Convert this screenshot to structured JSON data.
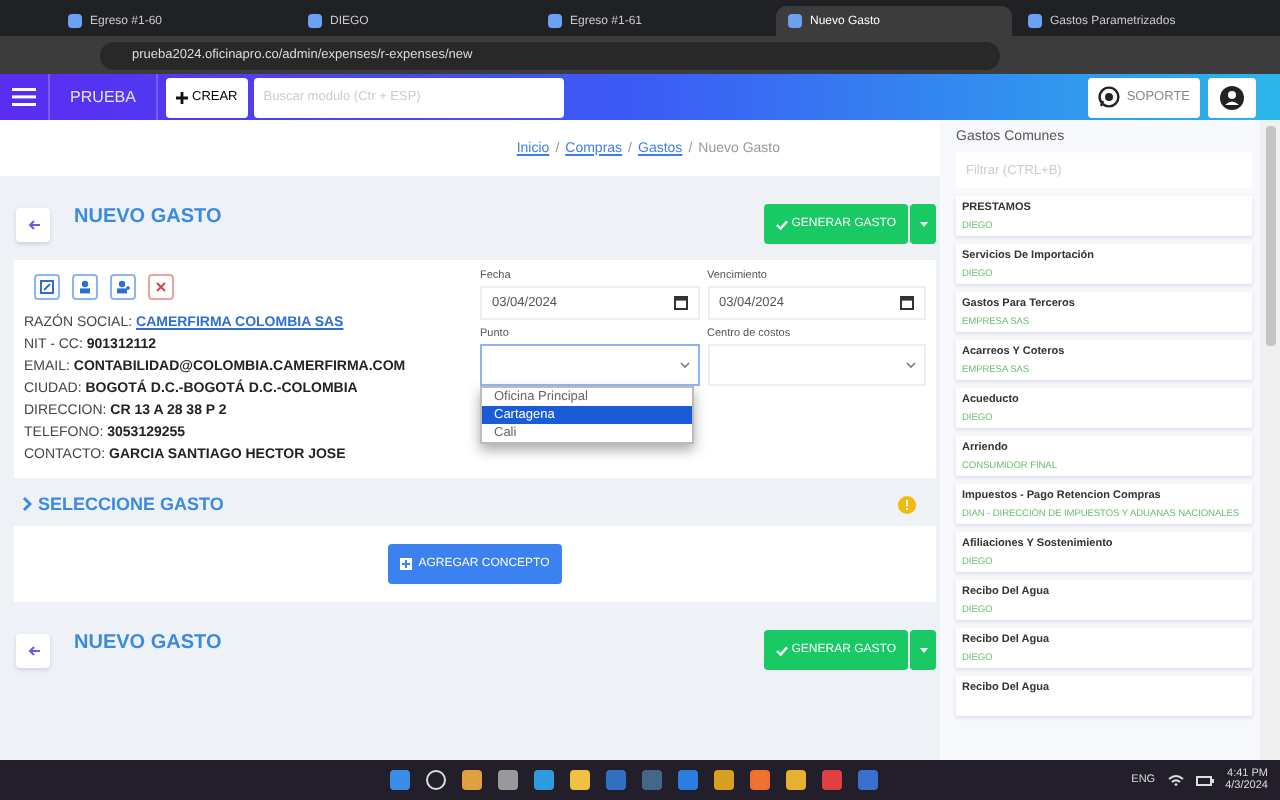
{
  "browser": {
    "tabs": [
      {
        "title": "Egreso #1-60",
        "selected": false
      },
      {
        "title": "DIEGO",
        "selected": false
      },
      {
        "title": "Egreso #1-61",
        "selected": false
      },
      {
        "title": "Nuevo Gasto",
        "selected": true
      },
      {
        "title": "Gastos Parametrizados",
        "selected": false
      }
    ],
    "url": "prueba2024.oficinapro.co/admin/expenses/r-expenses/new"
  },
  "app_header": {
    "brand": "PRUEBA",
    "create_button": "CREAR",
    "search": {
      "placeholder": "Buscar modulo (Ctr + ESP)"
    },
    "support_button": "SOPORTE"
  },
  "breadcrumb": [
    {
      "label": "Inicio",
      "kind": "link"
    },
    {
      "label": "Compras",
      "kind": "link"
    },
    {
      "label": "Gastos",
      "kind": "link"
    },
    {
      "label": "Nuevo Gasto",
      "kind": "current"
    }
  ],
  "separator": "/",
  "page_title": "NUEVO GASTO",
  "generate_button": "GENERAR GASTO",
  "supplier": [
    {
      "label": "RAZÓN SOCIAL:",
      "value": "CAMERFIRMA COLOMBIA SAS",
      "kind": "link"
    },
    {
      "label": "NIT - CC:",
      "value": "901312112",
      "kind": "plain"
    },
    {
      "label": "EMAIL:",
      "value": "CONTABILIDAD@COLOMBIA.CAMERFIRMA.COM",
      "kind": "plain"
    },
    {
      "label": "CIUDAD:",
      "value": "BOGOTÁ D.C.-BOGOTÁ D.C.-COLOMBIA",
      "kind": "plain"
    },
    {
      "label": "DIRECCION:",
      "value": "CR 13 A 28 38 P 2",
      "kind": "plain"
    },
    {
      "label": "TELEFONO:",
      "value": "3053129255",
      "kind": "plain"
    },
    {
      "label": "CONTACTO:",
      "value": "GARCIA SANTIAGO HECTOR JOSE",
      "kind": "plain"
    }
  ],
  "dates": [
    {
      "label": "Fecha",
      "value": "03/04/2024"
    },
    {
      "label": "Vencimiento",
      "value": "03/04/2024"
    }
  ],
  "punto": {
    "label": "Punto",
    "expanded": true,
    "options": [
      {
        "label": "Oficina Principal",
        "selected": false
      },
      {
        "label": "Cartagena",
        "selected": true
      },
      {
        "label": "Cali",
        "selected": false
      }
    ]
  },
  "cost_center": {
    "label": "Centro de costos"
  },
  "section_title": "SELECCIONE GASTO",
  "add_button": "AGREGAR CONCEPTO",
  "footer_title": "NUEVO GASTO",
  "footer_button": "GENERAR GASTO",
  "sidebar": {
    "title": "Gastos Comunes",
    "filter": {
      "placeholder": "Filtrar (CTRL+B)"
    },
    "items": [
      {
        "name": "PRESTAMOS",
        "party": "DIEGO"
      },
      {
        "name": "Servicios De Importación",
        "party": "DIEGO"
      },
      {
        "name": "Gastos Para Terceros",
        "party": "EMPRESA SAS"
      },
      {
        "name": "Acarreos Y Coteros",
        "party": "EMPRESA SAS"
      },
      {
        "name": "Acueducto",
        "party": "DIEGO"
      },
      {
        "name": "Arriendo",
        "party": "CONSUMIDOR FINAL"
      },
      {
        "name": "Impuestos - Pago Retencion Compras",
        "party": "DIAN - DIRECCIÓN DE IMPUESTOS Y ADUANAS NACIONALES"
      },
      {
        "name": "Afiliaciones Y Sostenimiento",
        "party": "DIEGO"
      },
      {
        "name": "Recibo Del Agua",
        "party": "DIEGO"
      },
      {
        "name": "Recibo Del Agua",
        "party": "DIEGO"
      },
      {
        "name": "Recibo Del Agua"
      }
    ]
  },
  "taskbar": {
    "language": "ENG",
    "time": "4:41 PM",
    "date": "4/3/2024"
  }
}
